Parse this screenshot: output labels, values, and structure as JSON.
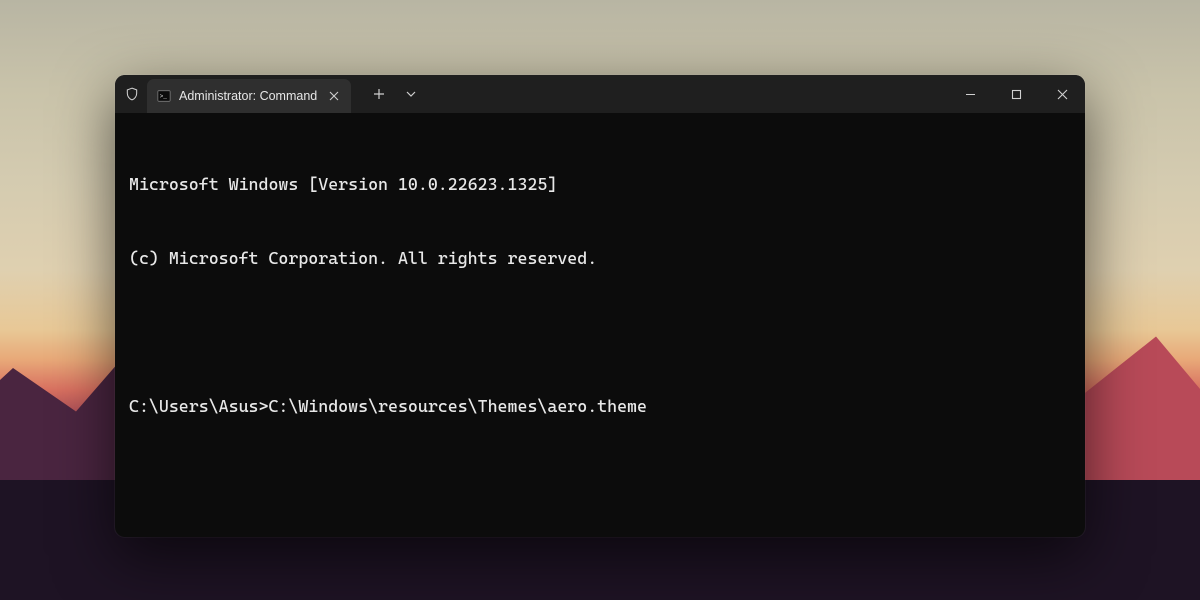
{
  "titlebar": {
    "tab_title": "Administrator: Command",
    "tab_icon": "cmd-icon",
    "shield_icon": "shield-icon",
    "close_tab_icon": "close-icon",
    "new_tab_icon": "plus-icon",
    "dropdown_icon": "chevron-down-icon",
    "minimize_icon": "minimize-icon",
    "maximize_icon": "maximize-icon",
    "close_window_icon": "close-icon"
  },
  "terminal": {
    "line1": "Microsoft Windows [Version 10.0.22623.1325]",
    "line2": "(c) Microsoft Corporation. All rights reserved.",
    "prompt": "C:\\Users\\Asus>",
    "command": "C:\\Windows\\resources\\Themes\\aero.theme"
  },
  "colors": {
    "window_bg": "#0c0c0c",
    "titlebar_bg": "#1f1f1f",
    "tab_bg": "#2f2f2f",
    "text": "#e8e8e8"
  }
}
